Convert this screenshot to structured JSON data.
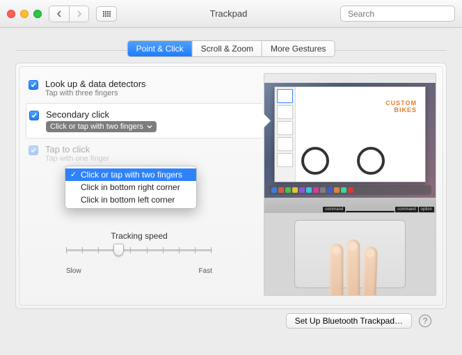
{
  "window": {
    "title": "Trackpad"
  },
  "search": {
    "placeholder": "Search"
  },
  "tabs": [
    "Point & Click",
    "Scroll & Zoom",
    "More Gestures"
  ],
  "options": {
    "lookup": {
      "label": "Look up & data detectors",
      "sub": "Tap with three fingers"
    },
    "secondary": {
      "label": "Secondary click",
      "selected": "Click or tap with two fingers"
    },
    "tapclick": {
      "label": "Tap to click",
      "sub": "Tap with one finger"
    }
  },
  "dropdown": {
    "items": [
      "Click or tap with two fingers",
      "Click in bottom right corner",
      "Click in bottom left corner"
    ]
  },
  "tracking": {
    "title": "Tracking speed",
    "min": "Slow",
    "max": "Fast"
  },
  "preview": {
    "headline1": "CUSTOM",
    "headline2": "BIKES",
    "keys": [
      "command",
      "command",
      "option"
    ]
  },
  "footer": {
    "bluetooth": "Set Up Bluetooth Trackpad…",
    "help": "?"
  }
}
